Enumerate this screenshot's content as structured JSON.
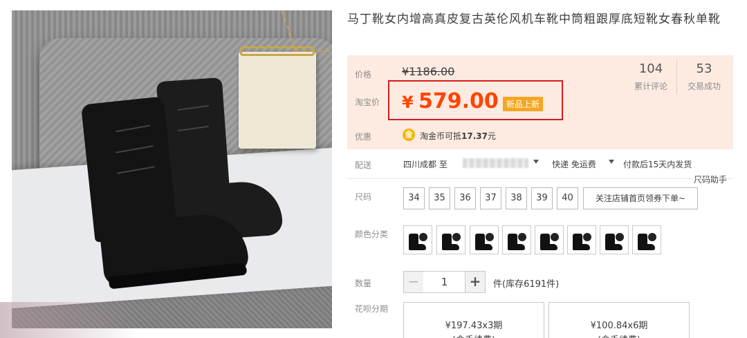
{
  "product": {
    "title": "马丁靴女内增高真皮复古英伦风机车靴中筒粗跟厚底短靴女春秋单靴",
    "image_icon": "boots-product-photo"
  },
  "price": {
    "label": "价格",
    "original": "¥1186.00",
    "taobao_label": "淘宝价",
    "currency": "¥",
    "current": "579.00",
    "badge": "新品上新",
    "accent_color": "#ff4400",
    "highlight_border": "#d71a1a"
  },
  "stats": {
    "reviews_count": "104",
    "reviews_label": "累计评论",
    "sales_count": "53",
    "sales_label": "交易成功"
  },
  "promo": {
    "label": "优惠",
    "icon": "coin-icon",
    "text_prefix": "淘金币可抵",
    "amount": "17.37",
    "text_suffix": "元"
  },
  "shipping": {
    "label": "配送",
    "origin": "四川成都 至",
    "method": "快递 免运费",
    "promise": "付款后15天内发货"
  },
  "size": {
    "label": "尺码",
    "helper": "尺码助手",
    "options": [
      "34",
      "35",
      "36",
      "37",
      "38",
      "39",
      "40"
    ],
    "follow_text": "关注店铺首页领券下单~"
  },
  "color": {
    "label": "颜色分类",
    "swatch_count": 9
  },
  "quantity": {
    "label": "数量",
    "minus": "−",
    "value": "1",
    "plus": "+",
    "stock_text": "件(库存6191件)"
  },
  "installment": {
    "label": "花呗分期",
    "options": [
      {
        "amount": "¥197.43x3期",
        "fee": "(含手续费)"
      },
      {
        "amount": "¥100.84x6期",
        "fee": "(含手续费)"
      }
    ]
  }
}
